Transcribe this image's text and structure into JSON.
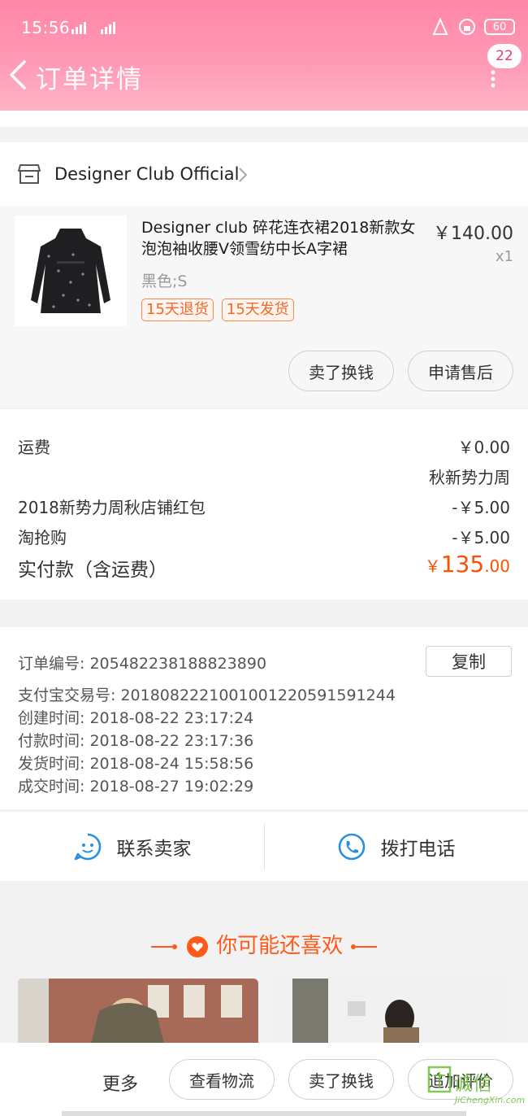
{
  "status": {
    "time": "15:56",
    "battery": "60"
  },
  "header": {
    "title": "订单详情",
    "badge": "22"
  },
  "shop": {
    "name": "Designer Club Official"
  },
  "product": {
    "title": "Designer club 碎花连衣裙2018新款女泡泡袖收腰V领雪纺中长A字裙",
    "price": "￥140.00",
    "qty": "x1",
    "variant": "黑色;S",
    "tags": [
      "15天退货",
      "15天发货"
    ],
    "btn_sell": "卖了换钱",
    "btn_aftersale": "申请售后"
  },
  "fees": {
    "shipping_label": "运费",
    "shipping_value": "￥0.00",
    "promo_name": "秋新势力周",
    "coupon_label": "2018新势力周秋店铺红包",
    "coupon_value": "-￥5.00",
    "flash_label": "淘抢购",
    "flash_value": "-￥5.00",
    "total_label": "实付款（含运费）",
    "total_symbol": "￥",
    "total_int": "135",
    "total_dec": ".00"
  },
  "order": {
    "order_no": "订单编号:   205482238188823890",
    "copy_label": "复制",
    "alipay_no": "支付宝交易号:   2018082221001001220591591244",
    "created": "创建时间:   2018-08-22 23:17:24",
    "paid": "付款时间:   2018-08-22 23:17:36",
    "shipped": "发货时间:   2018-08-24 15:58:56",
    "completed": "成交时间:   2018-08-27 19:02:29"
  },
  "contact": {
    "seller": "联系卖家",
    "phone": "拨打电话"
  },
  "recommend": {
    "title": "你可能还喜欢"
  },
  "bottom": {
    "more": "更多",
    "logistics": "查看物流",
    "sell": "卖了换钱",
    "review": "追加评价"
  },
  "watermark": {
    "main": "诚信",
    "sub": "JiChengXin.com"
  },
  "colors": {
    "header": "#ff8fae",
    "accent": "#ff5000",
    "tag": "#f06a2a"
  }
}
